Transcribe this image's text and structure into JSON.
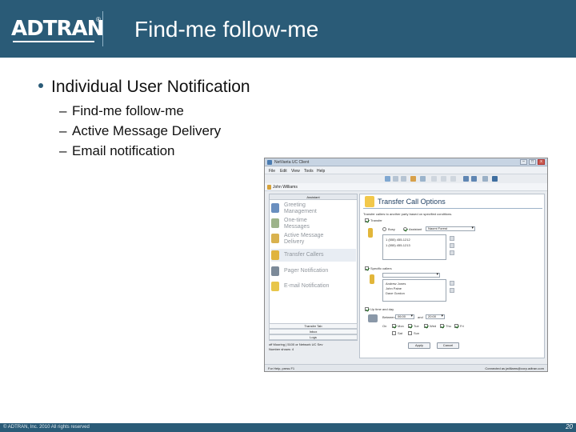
{
  "header": {
    "logo_text": "ADTRAN",
    "logo_reg": "®",
    "title": "Find-me follow-me"
  },
  "content": {
    "main_bullet": "Individual User Notification",
    "sub_bullets": [
      "Find-me follow-me",
      "Active Message Delivery",
      "Email notification"
    ]
  },
  "app": {
    "window_title": "NetVanta UC Client",
    "window_buttons": [
      "–",
      "□",
      "x"
    ],
    "menus": [
      "File",
      "Edit",
      "View",
      "Tools",
      "Help"
    ],
    "user_name": "John Williams",
    "nav_header": "Assistant",
    "nav_items": [
      {
        "label": "Greeting Management",
        "lines": [
          "Greeting",
          "Management"
        ],
        "icon": "greeting-icon",
        "color": "#6a8fbf"
      },
      {
        "label": "One-time Messages",
        "lines": [
          "One-time",
          "Messages"
        ],
        "icon": "message-icon",
        "color": "#9db38a"
      },
      {
        "label": "Active Message Delivery",
        "lines": [
          "Active Message",
          "Delivery"
        ],
        "icon": "delivery-icon",
        "color": "#d9b24e"
      },
      {
        "label": "Transfer Callers",
        "lines": [
          "Transfer Callers"
        ],
        "icon": "transfer-icon",
        "color": "#e0b43e"
      },
      {
        "label": "Pager Notification",
        "lines": [
          "Pager Notification"
        ],
        "icon": "pager-icon",
        "color": "#7c8a99"
      },
      {
        "label": "E-mail Notification",
        "lines": [
          "E-mail Notification"
        ],
        "icon": "email-icon",
        "color": "#e8c64a"
      }
    ],
    "nav_tabs": [
      "Transfer Tab",
      "Inbox",
      "Logs"
    ],
    "status_left_lines": [
      "off Mooring | 5100 or Network UC Sev",
      "Number shows: 4"
    ],
    "panel": {
      "title": "Transfer Call Options",
      "description": "Transfer callers to another party based on specified conditions.",
      "transfer_label": "Transfer",
      "radio_busy": "Busy",
      "radio_assistant": "Assistant",
      "assistant_value": "Naomi Forest",
      "transfer_entries": [
        "1 (555) 455-1212",
        "1 (555) 455-1213"
      ],
      "specific_callers_label": "Specific callers",
      "callers": [
        "Andrew Jones",
        "John Paine",
        "Dave Gordon"
      ],
      "time_label": "Up time and day",
      "between_label": "Between",
      "start_time": "06:00",
      "and_label": "and",
      "end_time": "20:00",
      "on_label": "On",
      "days": [
        {
          "label": "Mon",
          "checked": true
        },
        {
          "label": "Tue",
          "checked": true
        },
        {
          "label": "Wed",
          "checked": true
        },
        {
          "label": "Thu",
          "checked": true
        },
        {
          "label": "Fri",
          "checked": true
        },
        {
          "label": "Sat",
          "checked": false
        },
        {
          "label": "Sun",
          "checked": false
        }
      ],
      "apply_label": "Apply",
      "cancel_label": "Cancel"
    },
    "status_bar_left": "For Help, press F1",
    "status_bar_right": "Connected as jwilliams@corp.adtran.com"
  },
  "footer": {
    "copyright": "© ADTRAN, Inc. 2010 All rights reserved",
    "page_number": "20"
  },
  "colors": {
    "brand": "#2a5b77",
    "panel_title": "#1f3f62",
    "nav_text": "#8f959c"
  }
}
